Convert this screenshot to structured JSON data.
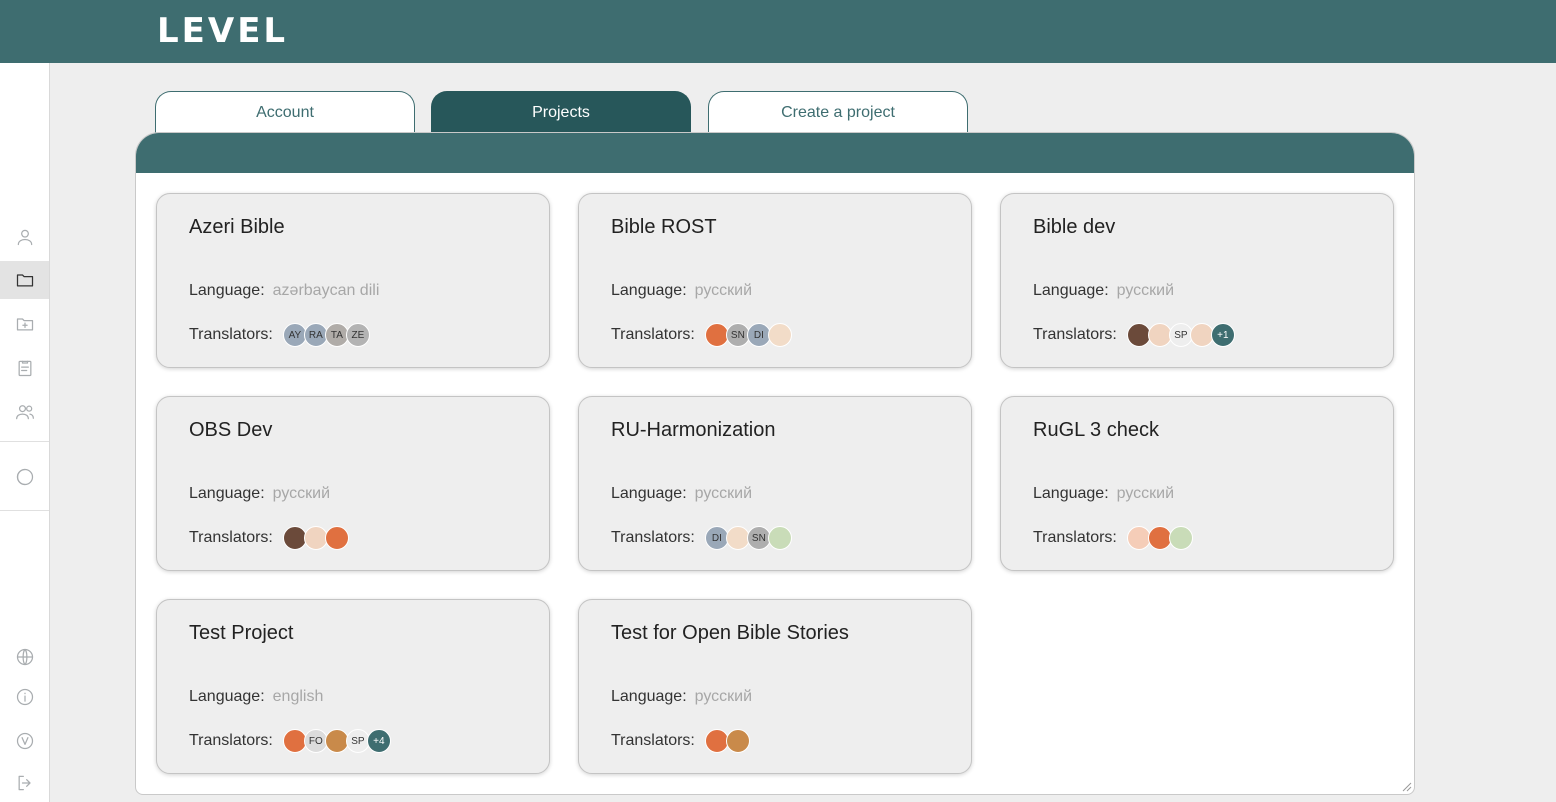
{
  "app": {
    "logo": "LEVEL"
  },
  "tabs": [
    {
      "label": "Account",
      "active": false
    },
    {
      "label": "Projects",
      "active": true
    },
    {
      "label": "Create a project",
      "active": false
    }
  ],
  "sidebar": {
    "items": [
      {
        "icon": "user-icon",
        "active": false
      },
      {
        "icon": "folder-icon",
        "active": true
      },
      {
        "icon": "folder-plus-icon",
        "active": false
      },
      {
        "icon": "clipboard-icon",
        "active": false
      },
      {
        "icon": "users-icon",
        "active": false
      },
      {
        "icon": "theme-toggle-icon",
        "active": false
      },
      {
        "icon": "globe-icon",
        "active": false
      },
      {
        "icon": "info-icon",
        "active": false
      },
      {
        "icon": "version-icon",
        "active": false
      },
      {
        "icon": "logout-icon",
        "active": false
      }
    ]
  },
  "labels": {
    "language": "Language:",
    "translators": "Translators:"
  },
  "projects": [
    {
      "title": "Azeri Bible",
      "language": "azərbaycan dili",
      "translators": [
        {
          "t": "AY",
          "bg": "#9aa8b8"
        },
        {
          "t": "RA",
          "bg": "#9aa8b8"
        },
        {
          "t": "TA",
          "bg": "#b0aca8"
        },
        {
          "t": "ZE",
          "bg": "#b3b3b3"
        }
      ]
    },
    {
      "title": "Bible ROST",
      "language": "русский",
      "translators": [
        {
          "t": "",
          "bg": "#e07040"
        },
        {
          "t": "SN",
          "bg": "#aeaeae"
        },
        {
          "t": "DI",
          "bg": "#9aa8b8"
        },
        {
          "t": "",
          "bg": "#f2dcc8"
        }
      ]
    },
    {
      "title": "Bible dev",
      "language": "русский",
      "translators": [
        {
          "t": "",
          "bg": "#6b4a3a"
        },
        {
          "t": "",
          "bg": "#f0d4c0"
        },
        {
          "t": "SP",
          "bg": "#eeeeee"
        },
        {
          "t": "",
          "bg": "#f0d4c0"
        },
        {
          "t": "+1",
          "bg": "#3e6d70",
          "c": "#ffffff"
        }
      ]
    },
    {
      "title": "OBS Dev",
      "language": "русский",
      "translators": [
        {
          "t": "",
          "bg": "#6b4a3a"
        },
        {
          "t": "",
          "bg": "#f0d4c0"
        },
        {
          "t": "",
          "bg": "#e07040"
        }
      ]
    },
    {
      "title": "RU-Harmonization",
      "language": "русский",
      "translators": [
        {
          "t": "DI",
          "bg": "#9aa8b8"
        },
        {
          "t": "",
          "bg": "#f2dcc8"
        },
        {
          "t": "SN",
          "bg": "#aeaeae"
        },
        {
          "t": "",
          "bg": "#c9dcb8"
        }
      ]
    },
    {
      "title": "RuGL 3 check",
      "language": "русский",
      "translators": [
        {
          "t": "",
          "bg": "#f5cdb8"
        },
        {
          "t": "",
          "bg": "#e07040"
        },
        {
          "t": "",
          "bg": "#c9dcb8"
        }
      ]
    },
    {
      "title": "Test Project",
      "language": "english",
      "translators": [
        {
          "t": "",
          "bg": "#e07040"
        },
        {
          "t": "FO",
          "bg": "#dcdcdc"
        },
        {
          "t": "",
          "bg": "#c98a4a"
        },
        {
          "t": "SP",
          "bg": "#eeeeee"
        },
        {
          "t": "+4",
          "bg": "#3e6d70",
          "c": "#ffffff"
        }
      ]
    },
    {
      "title": "Test for Open Bible Stories",
      "language": "русский",
      "translators": [
        {
          "t": "",
          "bg": "#e07040"
        },
        {
          "t": "",
          "bg": "#c98a4a"
        }
      ]
    }
  ]
}
